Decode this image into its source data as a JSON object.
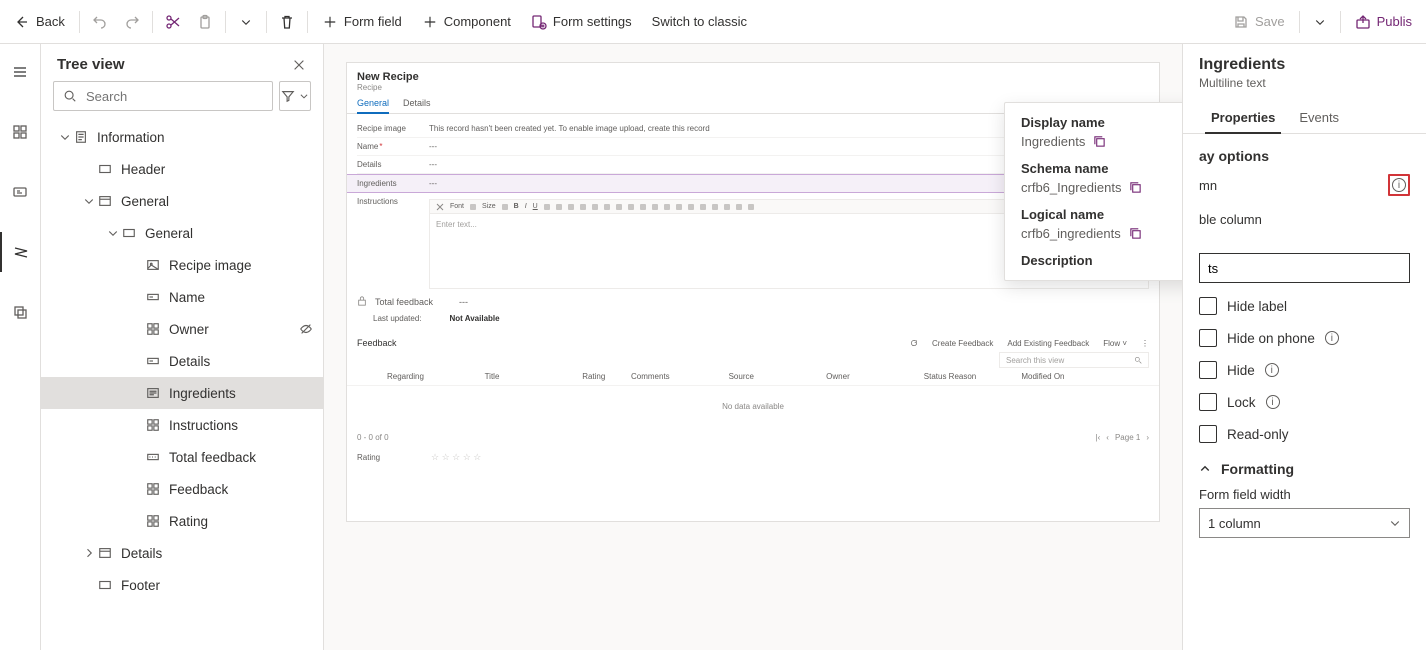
{
  "cmdbar": {
    "back": "Back",
    "form_field": "Form field",
    "component": "Component",
    "form_settings": "Form settings",
    "switch_classic": "Switch to classic",
    "save": "Save",
    "publish": "Publis"
  },
  "tree": {
    "title": "Tree view",
    "search_placeholder": "Search",
    "nodes": {
      "information": "Information",
      "header": "Header",
      "general1": "General",
      "general2": "General",
      "recipe_image": "Recipe image",
      "name": "Name",
      "owner": "Owner",
      "details": "Details",
      "ingredients": "Ingredients",
      "instructions": "Instructions",
      "total_feedback": "Total feedback",
      "feedback": "Feedback",
      "rating": "Rating",
      "details2": "Details",
      "footer": "Footer"
    }
  },
  "form": {
    "title": "New Recipe",
    "subtitle": "Recipe",
    "tabs": {
      "general": "General",
      "details": "Details"
    },
    "rows": {
      "recipe_image": "Recipe image",
      "recipe_image_msg": "This record hasn't been created yet. To enable image upload, create this record",
      "name": "Name",
      "details": "Details",
      "ingredients": "Ingredients",
      "instructions": "Instructions",
      "editor_placeholder": "Enter text...",
      "font_label": "Font",
      "size_label": "Size",
      "total_feedback": "Total feedback",
      "last_updated": "Last updated:",
      "not_available": "Not Available",
      "feedback": "Feedback"
    },
    "feedback_actions": {
      "create": "Create Feedback",
      "add_existing": "Add Existing Feedback",
      "flow": "Flow"
    },
    "feedback_search_placeholder": "Search this view",
    "feedback_cols": [
      "Regarding",
      "Title",
      "Rating",
      "Comments",
      "Source",
      "Owner",
      "Status Reason",
      "Modified On"
    ],
    "no_data": "No data available",
    "pager": {
      "range": "0 - 0 of 0",
      "page": "Page 1"
    },
    "rating_label": "Rating"
  },
  "popover": {
    "display_name_label": "Display name",
    "display_name_value": "Ingredients",
    "schema_name_label": "Schema name",
    "schema_name_value": "crfb6_Ingredients",
    "logical_name_label": "Logical name",
    "logical_name_value": "crfb6_ingredients",
    "description_label": "Description"
  },
  "rpane": {
    "title": "Ingredients",
    "subtitle": "Multiline text",
    "tabs": {
      "properties": "Properties",
      "events": "Events"
    },
    "display_options": "ay options",
    "column_suffix": "mn",
    "table_column": "ble column",
    "label_value": "ts",
    "hide_label": "Hide label",
    "hide_on_phone": "Hide on phone",
    "hide": "Hide",
    "lock": "Lock",
    "read_only": "Read-only",
    "formatting": "Formatting",
    "form_field_width": "Form field width",
    "width_value": "1 column"
  }
}
